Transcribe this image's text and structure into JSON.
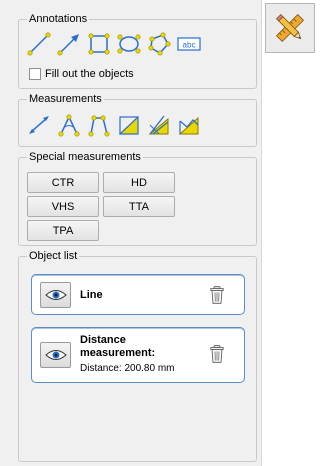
{
  "annotations": {
    "title": "Annotations",
    "tools": [
      {
        "icon": "line-tool-icon"
      },
      {
        "icon": "arrow-tool-icon"
      },
      {
        "icon": "rectangle-tool-icon"
      },
      {
        "icon": "ellipse-tool-icon"
      },
      {
        "icon": "polygon-tool-icon"
      },
      {
        "icon": "text-tool-icon",
        "text": "abc"
      }
    ],
    "fill_label": "Fill out the objects",
    "fill_checked": false
  },
  "measurements": {
    "title": "Measurements",
    "tools": [
      {
        "icon": "distance-tool-icon"
      },
      {
        "icon": "angle-tool-icon"
      },
      {
        "icon": "open-angle-tool-icon"
      },
      {
        "icon": "area-tool-icon"
      },
      {
        "icon": "area-angle-tool-icon"
      },
      {
        "icon": "area-polygon-tool-icon"
      }
    ]
  },
  "special_measurements": {
    "title": "Special measurements",
    "buttons": [
      "CTR",
      "HD",
      "VHS",
      "TTA",
      "TPA"
    ]
  },
  "object_list": {
    "title": "Object list",
    "items": [
      {
        "title": "Line",
        "subtitle": ""
      },
      {
        "title": "Distance measurement:",
        "subtitle": "Distance: 200.80 mm"
      }
    ]
  },
  "colors": {
    "panel_bg": "#f0f0f0",
    "card_border": "#5b8fc4",
    "tool_yellow": "#e8d800",
    "tool_line": "#2a6fd0"
  }
}
